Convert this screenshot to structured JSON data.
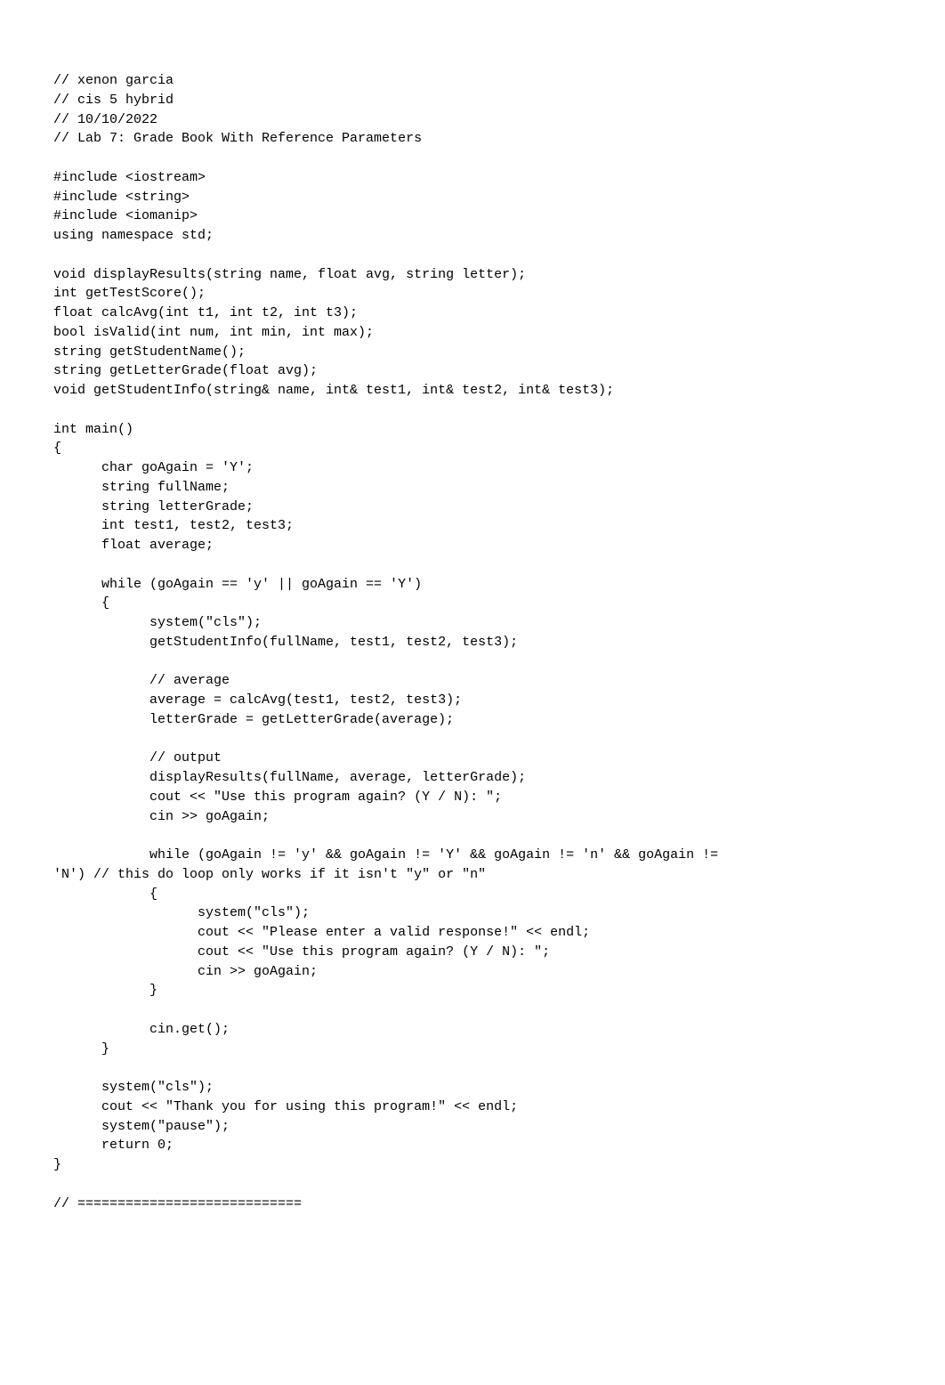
{
  "code": {
    "lines": [
      "// xenon garcia",
      "// cis 5 hybrid",
      "// 10/10/2022",
      "// Lab 7: Grade Book With Reference Parameters",
      "",
      "#include <iostream>",
      "#include <string>",
      "#include <iomanip>",
      "using namespace std;",
      "",
      "void displayResults(string name, float avg, string letter);",
      "int getTestScore();",
      "float calcAvg(int t1, int t2, int t3);",
      "bool isValid(int num, int min, int max);",
      "string getStudentName();",
      "string getLetterGrade(float avg);",
      "void getStudentInfo(string& name, int& test1, int& test2, int& test3);",
      "",
      "int main()",
      "{",
      "      char goAgain = 'Y';",
      "      string fullName;",
      "      string letterGrade;",
      "      int test1, test2, test3;",
      "      float average;",
      "",
      "      while (goAgain == 'y' || goAgain == 'Y')",
      "      {",
      "            system(\"cls\");",
      "            getStudentInfo(fullName, test1, test2, test3);",
      "",
      "            // average",
      "            average = calcAvg(test1, test2, test3);",
      "            letterGrade = getLetterGrade(average);",
      "",
      "            // output",
      "            displayResults(fullName, average, letterGrade);",
      "            cout << \"Use this program again? (Y / N): \";",
      "            cin >> goAgain;",
      "",
      "            while (goAgain != 'y' && goAgain != 'Y' && goAgain != 'n' && goAgain != ",
      "'N') // this do loop only works if it isn't \"y\" or \"n\"",
      "            {",
      "                  system(\"cls\");",
      "                  cout << \"Please enter a valid response!\" << endl;",
      "                  cout << \"Use this program again? (Y / N): \";",
      "                  cin >> goAgain;",
      "            }",
      "",
      "            cin.get();",
      "      }",
      "",
      "      system(\"cls\");",
      "      cout << \"Thank you for using this program!\" << endl;",
      "      system(\"pause\");",
      "      return 0;",
      "}",
      "",
      "// ============================"
    ]
  }
}
